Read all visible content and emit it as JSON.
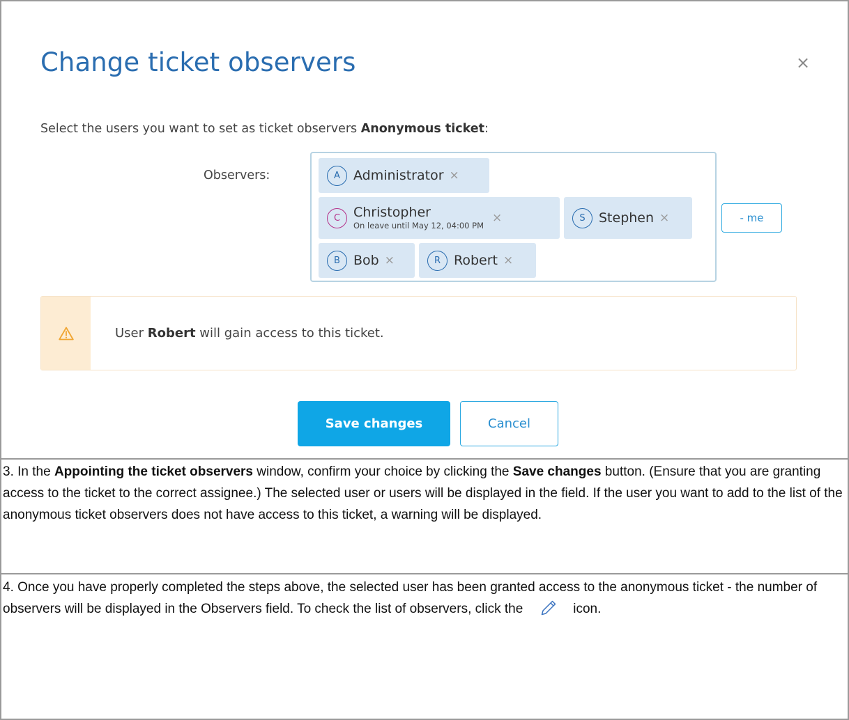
{
  "dialog": {
    "title": "Change ticket observers",
    "close_glyph": "×",
    "intro_prefix": "Select the users you want to set as ticket observers ",
    "intro_bold": "Anonymous ticket",
    "intro_suffix": ":",
    "observers_label": "Observers:",
    "observers": [
      {
        "initial": "A",
        "name": "Administrator",
        "remove": "×"
      },
      {
        "initial": "C",
        "name": "Christopher",
        "subtitle": "On leave until May 12, 04:00 PM",
        "remove": "×",
        "avatar_color": "#b5338a"
      },
      {
        "initial": "S",
        "name": "Stephen",
        "remove": "×"
      },
      {
        "initial": "B",
        "name": "Bob",
        "remove": "×"
      },
      {
        "initial": "R",
        "name": "Robert",
        "remove": "×"
      }
    ],
    "me_button": "- me",
    "alert": {
      "icon": "warning-icon",
      "prefix": "User ",
      "bold": "Robert",
      "suffix": " will gain access to this ticket."
    },
    "save_button": "Save changes",
    "cancel_button": "Cancel"
  },
  "instructions": {
    "step3": {
      "a": "3. In the ",
      "b1": "Appointing the ticket observers",
      "c": " window, confirm your choice by clicking the ",
      "b2": "Save changes",
      "d": " button. (Ensure that you are granting access to the ticket to the correct assignee.) The selected user or users will be displayed in the field. If the user you want to add to the list of the anonymous ticket observers does not have access to this ticket, a warning will be displayed."
    },
    "step4": {
      "a": "4. Once you have properly completed the steps above, the selected user has been granted access to the anonymous ticket - the number of observers will be displayed in the Observers field. To check the list of observers, click the",
      "icon": "pencil-icon",
      "b": "icon."
    }
  },
  "colors": {
    "title": "#2a6db0",
    "primary_button": "#0fa6e6",
    "chip_bg": "#d9e7f4",
    "alert_side": "#fdecd3"
  }
}
